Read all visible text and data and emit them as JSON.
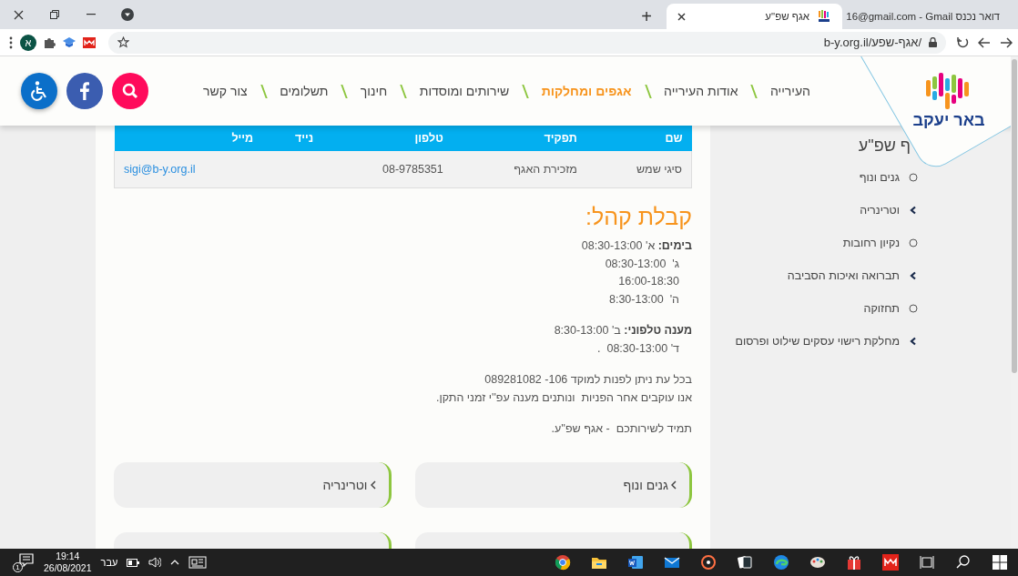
{
  "browser": {
    "tabs": [
      {
        "title": "16@gmail.com - Gmail דואר נכנס",
        "kind": "mail",
        "selected": false
      },
      {
        "title": "אגף שפ\"ע",
        "kind": "site",
        "selected": true
      }
    ],
    "new_tab": "+",
    "url": "b-y.org.il/אגף-שפע/",
    "profile_initial": "א"
  },
  "header": {
    "logo_text": "באר יעקב",
    "nav": [
      {
        "label": "העירייה",
        "selected": false
      },
      {
        "label": "אודות העירייה",
        "selected": false
      },
      {
        "label": "אגפים ומחלקות",
        "selected": true
      },
      {
        "label": "שירותים ומוסדות",
        "selected": false
      },
      {
        "label": "חינוך",
        "selected": false
      },
      {
        "label": "תשלומים",
        "selected": false
      },
      {
        "label": "צור קשר",
        "selected": false
      }
    ]
  },
  "staff_table": {
    "columns": [
      "שם",
      "תפקיד",
      "טלפון",
      "נייד",
      "מייל"
    ],
    "rows": [
      {
        "name": "סיגי שמש",
        "role": "מזכירת האגף",
        "phone": "08-9785351",
        "email": "sigi@b-y.org.il"
      }
    ]
  },
  "reception": {
    "title": "קבלת קהל:",
    "blocks": [
      {
        "kind": "schedule",
        "lines": [
          "**בימים:** א' 08:30-13:00",
          "ג'  08:30-13:00",
          "16:00-18:30",
          "ה'  8:30-13:00"
        ]
      },
      {
        "kind": "schedule",
        "lines": [
          "**מענה טלפוני:** ב' 8:30-13:00",
          "ד' 08:30-13:00  ."
        ]
      },
      {
        "kind": "text",
        "lines": [
          "בכל עת ניתן לפנות למוקד 106- 089281082",
          "אנו עוקבים אחר הפניות  ונותנים מענה עפ''י זמני התקן."
        ]
      },
      {
        "kind": "text",
        "lines": [
          "תמיד לשירותכם  - אגף שפ''ע."
        ]
      }
    ]
  },
  "cards": [
    {
      "label": "גנים ונוף"
    },
    {
      "label": "וטרינריה"
    }
  ],
  "sidebar": {
    "title": "ף שפ\"ע",
    "items": [
      {
        "label": "גנים ונוף",
        "kind": "link"
      },
      {
        "label": "וטרינריה",
        "kind": "group"
      },
      {
        "label": "נקיון רחובות",
        "kind": "link"
      },
      {
        "label": "תברואה ואיכות הסביבה",
        "kind": "group"
      },
      {
        "label": "תחזוקה",
        "kind": "link"
      },
      {
        "label": "מחלקת רישוי עסקים שילוט ופרסום",
        "kind": "group"
      }
    ]
  },
  "taskbar": {
    "time": "19:14",
    "date": "26/08/2021",
    "language": "עבר",
    "notifications": "1"
  }
}
